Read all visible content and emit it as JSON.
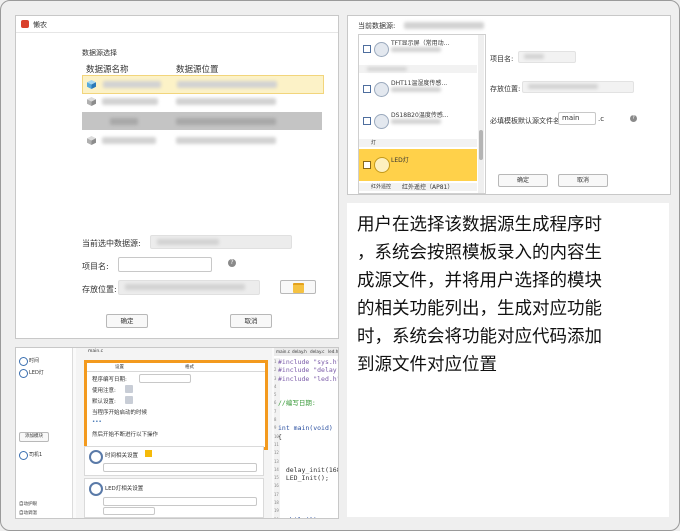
{
  "dialog_a": {
    "title": "懒农",
    "section_label": "数据源选择",
    "columns": [
      "数据源名称",
      "数据源位置"
    ],
    "current_label": "当前选中数据源:",
    "project_label": "项目名:",
    "location_label": "存放位置:",
    "ok_label": "确定",
    "cancel_label": "取消"
  },
  "dialog_b": {
    "header_label": "当前数据源:",
    "items": [
      "TFT显示屏（常用动...",
      "DHT11温湿度传感...",
      "DS18B20温度传感...",
      "LED灯",
      "红外遥控（AP81）"
    ],
    "group_light": "灯",
    "group_ir": "红外遥控",
    "project_label": "项目名:",
    "location_label": "存放位置:",
    "template_label": "必填模板默认源文件名:",
    "filename_value": "main",
    "ext_label": ".c",
    "ok_label": "确定",
    "cancel_label": "取消"
  },
  "editor": {
    "sidebar_item1": "时间",
    "sidebar_item2": "LED灯",
    "add_module": "添加模块",
    "sidebar_item3": "司机1",
    "bottom_item1": "自动护眼",
    "bottom_item2": "自动调温",
    "main_tab": "main.c",
    "tabs": [
      "main.c",
      "delay.h",
      "delay.c",
      "led.h"
    ],
    "settings_tab": "设置",
    "format_tab": "格式",
    "rows": [
      "程序编写日期:",
      "使用注意:",
      "默认设置:",
      "当程序开始启动的时候",
      "然后开始不断进行以下操作"
    ],
    "dots": "•••",
    "time_section": "时间相关设置",
    "led_section": "LED灯相关设置",
    "code_lines": [
      "#include \"sys.h\"",
      "#include \"delay.h\"",
      "#include \"led.h\"",
      "",
      "",
      "//编写日期:",
      "",
      "",
      "int main(void)",
      "{",
      "",
      "",
      "",
      "  delay_init(168);",
      "  LED_Init();",
      "",
      "",
      "",
      "",
      "  while(1)"
    ],
    "line_numbers": [
      "1",
      "2",
      "3",
      "4",
      "5",
      "6",
      "7",
      "8",
      "9",
      "10",
      "11",
      "12",
      "13",
      "14",
      "15",
      "16",
      "17",
      "18",
      "19",
      "20"
    ]
  },
  "description": {
    "lines": [
      "用户在选择该数据源生成程序时",
      "，系统会按照模板录入的内容生",
      "成源文件，并将用户选择的模块",
      "的相关功能列出，生成对应功能",
      "时，系统会将功能对应代码添加",
      "到源文件对应位置"
    ]
  },
  "colors": {
    "selected": "#ffd14a",
    "highlight": "#f5ba0a",
    "orange_border": "#f39a1e"
  }
}
